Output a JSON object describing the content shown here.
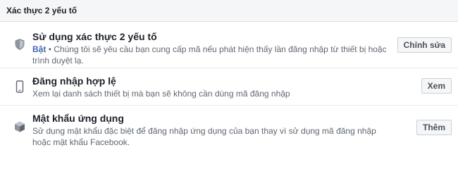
{
  "section": {
    "title": "Xác thực 2 yếu tố"
  },
  "rows": [
    {
      "icon": "shield-icon",
      "title": "Sử dụng xác thực 2 yếu tố",
      "status": "Bật",
      "separator": "•",
      "description": "Chúng tôi sẽ yêu cầu bạn cung cấp mã nếu phát hiện thấy lần đăng nhập từ thiết bị hoặc trình duyệt lạ.",
      "button": "Chỉnh sửa"
    },
    {
      "icon": "phone-icon",
      "title": "Đăng nhập hợp lệ",
      "description": "Xem lại danh sách thiết bị mà bạn sẽ không cần dùng mã đăng nhập",
      "button": "Xem"
    },
    {
      "icon": "box-icon",
      "title": "Mật khẩu ứng dụng",
      "description": "Sử dụng mật khẩu đặc biệt để đăng nhập ứng dụng của bạn thay vì sử dụng mã đăng nhập hoặc mật khẩu Facebook.",
      "button": "Thêm"
    }
  ]
}
